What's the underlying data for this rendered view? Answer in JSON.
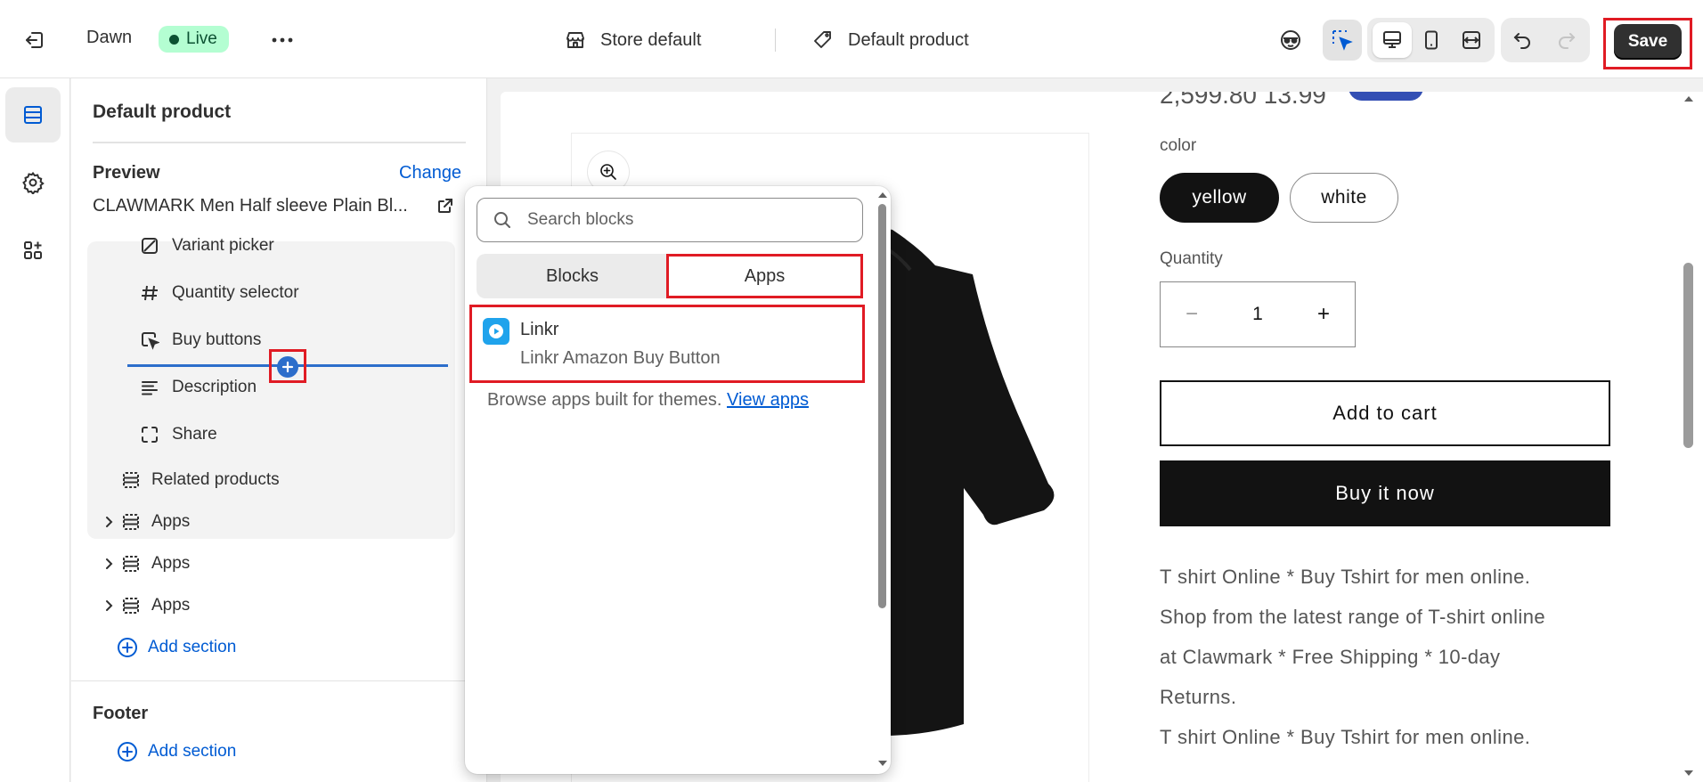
{
  "topbar": {
    "theme_name": "Dawn",
    "status_badge": "Live",
    "store_context": "Store default",
    "product_context": "Default product",
    "save_label": "Save"
  },
  "sidebar": {
    "title": "Default product",
    "preview_label": "Preview",
    "change_label": "Change",
    "preview_product": "CLAWMARK Men Half sleeve Plain Bl...",
    "blocks": [
      {
        "label": "Variant picker",
        "icon": "variant-picker-icon"
      },
      {
        "label": "Quantity selector",
        "icon": "hash-icon"
      },
      {
        "label": "Buy buttons",
        "icon": "cursor-click-icon"
      },
      {
        "label": "Description",
        "icon": "text-align-icon"
      },
      {
        "label": "Share",
        "icon": "share-frame-icon"
      }
    ],
    "sections": [
      {
        "label": "Related products"
      },
      {
        "label": "Apps"
      },
      {
        "label": "Apps"
      },
      {
        "label": "Apps"
      }
    ],
    "add_section": "Add section",
    "footer_title": "Footer",
    "footer_add_section": "Add section"
  },
  "picker": {
    "search_placeholder": "Search blocks",
    "tabs": [
      {
        "label": "Blocks",
        "selected": false
      },
      {
        "label": "Apps",
        "selected": true
      }
    ],
    "app_items": [
      {
        "name": "Linkr",
        "subtitle": "Linkr Amazon Buy Button"
      }
    ],
    "browse_text": "Browse apps built for themes.",
    "browse_link": "View apps"
  },
  "preview": {
    "price_strip": "2,599.80   13.99",
    "option_label": "color",
    "options": [
      "yellow",
      "white"
    ],
    "selected_option": "yellow",
    "quantity_label": "Quantity",
    "quantity_value": "1",
    "add_to_cart": "Add to cart",
    "buy_now": "Buy it now",
    "description_lines": [
      "T shirt Online * Buy Tshirt for men online.",
      "Shop from the latest range of T-shirt online",
      "at Clawmark * Free Shipping * 10-day",
      "Returns.",
      "T shirt Online * Buy Tshirt for men online."
    ]
  },
  "colors": {
    "accent_blue": "#005bd3",
    "highlight_red": "#e01b24",
    "live_badge_bg": "#b4fed2",
    "save_bg": "#303030",
    "app_logo": "#1fa3ec"
  }
}
